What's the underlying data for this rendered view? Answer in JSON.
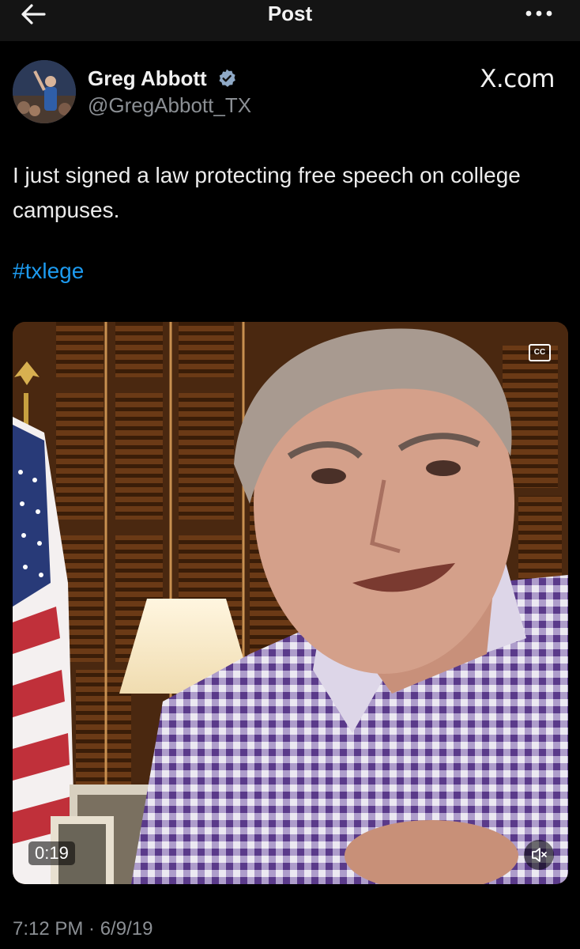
{
  "header": {
    "title": "Post",
    "back_icon": "arrow-left-icon",
    "more_icon": "more-horizontal-icon"
  },
  "author": {
    "name": "Greg Abbott",
    "handle": "@GregAbbott_TX",
    "verified": true,
    "verified_color": "#8fa9c6"
  },
  "source_label": "X.com",
  "tweet": {
    "text": "I just signed a law protecting free speech on college campuses.",
    "hashtag": "#txlege",
    "hashtag_color": "#1d9bf0"
  },
  "video": {
    "cc_label": "CC",
    "duration": "0:19",
    "mute_icon": "volume-muted-icon"
  },
  "timestamp": "7:12 PM · 6/9/19"
}
